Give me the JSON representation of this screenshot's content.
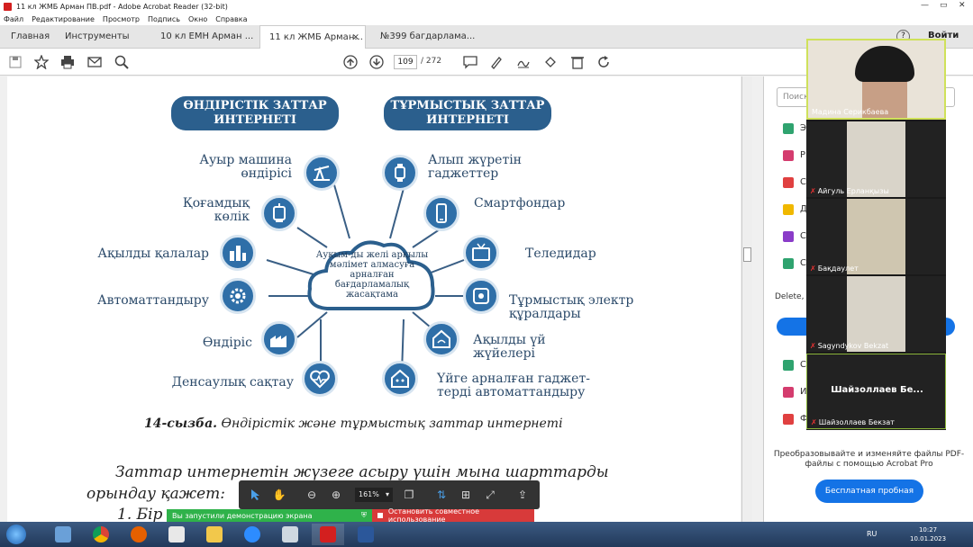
{
  "window": {
    "title": "11 кл ЖМБ Арман ПВ.pdf - Adobe Acrobat Reader (32-bit)"
  },
  "menu": [
    "Файл",
    "Редактирование",
    "Просмотр",
    "Подпись",
    "Окно",
    "Справка"
  ],
  "tabs": [
    "Главная",
    "Инструменты",
    "10 кл ЕМН Арман ...",
    "11 кл ЖМБ Арман...",
    "№399 багдарлама..."
  ],
  "tab_close": "×",
  "signin": "Войти",
  "help": "?",
  "page": {
    "current": "109",
    "sep_total": "/ 272"
  },
  "diagram": {
    "headers": [
      "ӨНДІРІСТІК ЗАТТАР ИНТЕРНЕТІ",
      "ТҰРМЫСТЫҚ ЗАТТАР ИНТЕРНЕТІ"
    ],
    "cloud": "Ауқым-ды желі арқылы мәлімет алмасуға арналған бағдарламалық жасақтама",
    "left": [
      "Ауыр машина өндірісі",
      "Қоғамдық көлік",
      "Ақылды қалалар",
      "Автоматтандыру",
      "Өндіріс",
      "Денсаулық сақтау"
    ],
    "right": [
      "Алып жүретін гаджеттер",
      "Смартфондар",
      "Теледидар",
      "Тұрмыстық электр құралдары",
      "Ақылды үй жүйелері",
      "Үйге арналған гаджет-терді автоматтандыру"
    ]
  },
  "caption": {
    "num": "14-сызба.",
    "text": "Өндірістік және тұрмыстық заттар интернеті"
  },
  "body": {
    "line1": "Заттар интернетін жүзеге асыру үшін мына шарттарды",
    "line2": "орындау қажет:",
    "line3": "1. Бір"
  },
  "floatbar": {
    "zoom": "161%"
  },
  "share": {
    "msg": "Вы запустили демонстрацию экрана",
    "stop": "Остановить совместное использование"
  },
  "rightpane": {
    "search": "Поиск",
    "items": [
      "Э",
      "Р",
      "С",
      "Д",
      "С",
      "С"
    ],
    "delete_note": "Delete, in",
    "items2": [
      "С",
      "И",
      "Ф"
    ],
    "promo": "Преобразовывайте и изменяйте файлы PDF-файлы с помощью Acrobat Pro",
    "trial": "Бесплатная пробная версия"
  },
  "participants": [
    "Мадина Серикбаева",
    "Айгуль Ерланқызы",
    "Бақдаулет",
    "Sagyndykov Bekzat",
    "Шайзоллаев Бекзат"
  ],
  "participant_big": "Шайзоллаев Бе...",
  "taskbar": {
    "lang": "RU",
    "time": "10:27",
    "date": "10.01.2023"
  }
}
